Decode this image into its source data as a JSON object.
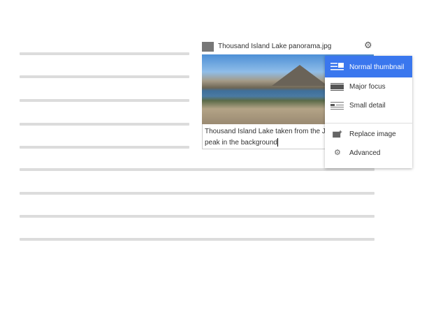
{
  "figure": {
    "title": "Thousand Island Lake panorama.jpg",
    "caption": "Thousand Island Lake taken from the John Banner peak in the background",
    "icon": "image-icon",
    "settings_icon": "gear-icon"
  },
  "menu": {
    "accent": "#3a77ee",
    "items": [
      {
        "label": "Normal thumbnail",
        "icon": "normal-thumbnail-icon",
        "selected": true
      },
      {
        "label": "Major focus",
        "icon": "major-focus-icon"
      },
      {
        "label": "Small detail",
        "icon": "small-detail-icon"
      },
      {
        "label": "Replace image",
        "icon": "replace-image-icon"
      },
      {
        "label": "Advanced",
        "icon": "gear-icon"
      }
    ]
  }
}
